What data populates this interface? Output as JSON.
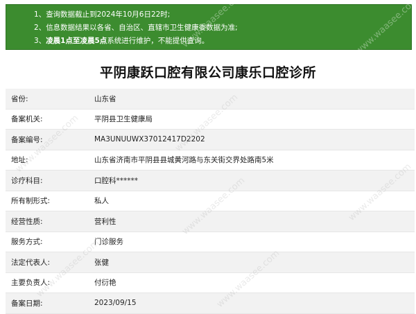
{
  "notice": {
    "lines": [
      {
        "num": "1、",
        "text": "查询数据截止到2024年10月6日22时;"
      },
      {
        "num": "2、",
        "text": "信息数据结果以各省、自治区、直辖市卫生健康委数据为准;"
      },
      {
        "num": "3、",
        "bold": "凌晨1点至凌晨5点",
        "text": "系统进行维护，不能提供查询。"
      }
    ]
  },
  "title": "平阴康跃口腔有限公司康乐口腔诊所",
  "rows": [
    {
      "label": "省份:",
      "value": "山东省"
    },
    {
      "label": "备案机关:",
      "value": "平阴县卫生健康局"
    },
    {
      "label": "备案编号:",
      "value": "MA3UNUUWX37012417D2202"
    },
    {
      "label": "地址:",
      "value": "山东省济南市平阴县县城黄河路与东关街交界处路南5米"
    },
    {
      "label": "诊疗科目:",
      "value": "口腔科******"
    },
    {
      "label": "所有制形式:",
      "value": "私人"
    },
    {
      "label": "经营性质:",
      "value": "营利性"
    },
    {
      "label": "服务方式:",
      "value": "门诊服务"
    },
    {
      "label": "法定代表人:",
      "value": "张健"
    },
    {
      "label": "主要负责人:",
      "value": "付衍艳"
    },
    {
      "label": "备案日期:",
      "value": "2023/09/15"
    }
  ],
  "watermark": "www.waasee.com"
}
